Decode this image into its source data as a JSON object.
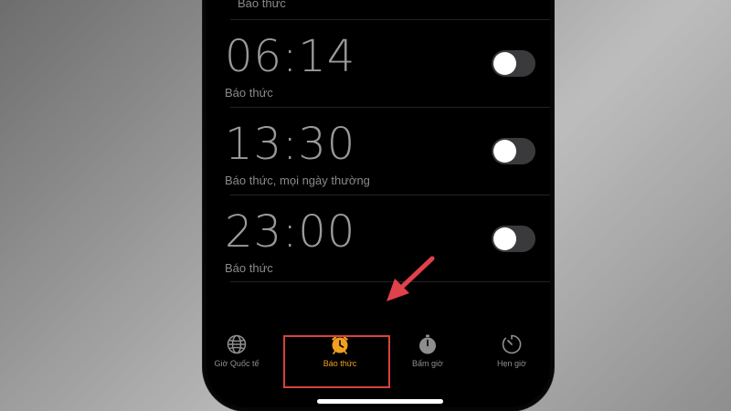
{
  "top_alarm": {
    "label": "Báo thức"
  },
  "alarms": [
    {
      "time": "06:14",
      "label": "Báo thức",
      "enabled": false
    },
    {
      "time": "13:30",
      "label": "Báo thức, mọi ngày thường",
      "enabled": false
    },
    {
      "time": "23:00",
      "label": "Báo thức",
      "enabled": false
    }
  ],
  "tabs": [
    {
      "label": "Giờ Quốc tế",
      "icon": "globe-icon",
      "active": false
    },
    {
      "label": "Báo thức",
      "icon": "alarm-clock-icon",
      "active": true
    },
    {
      "label": "Bấm giờ",
      "icon": "stopwatch-icon",
      "active": false
    },
    {
      "label": "Hẹn giờ",
      "icon": "timer-icon",
      "active": false
    }
  ],
  "colors": {
    "accent": "#f0a020",
    "annotation": "#d8413f",
    "toggle_off": "#3a3a3c"
  }
}
